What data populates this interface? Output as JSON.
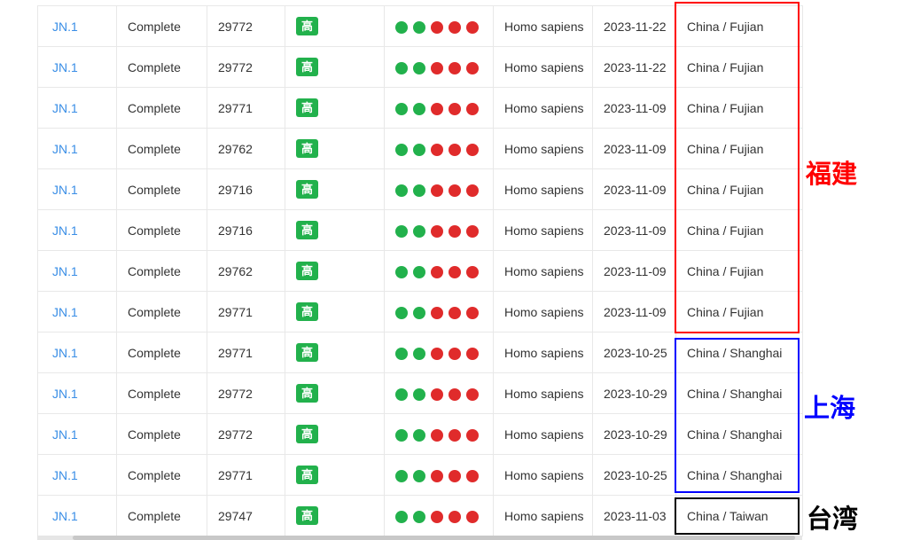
{
  "colors": {
    "dot_green": "#22b14c",
    "dot_red": "#e02b2b",
    "badge": "#22b14c",
    "link": "#3a8ee6",
    "fujian": "#ff0000",
    "shanghai": "#0000ff",
    "taiwan": "#000000"
  },
  "rows": [
    {
      "lineage": "JN.1",
      "status": "Complete",
      "length": "29772",
      "quality": "高",
      "dots": [
        "green",
        "green",
        "red",
        "red",
        "red"
      ],
      "host": "Homo sapiens",
      "date": "2023-11-22",
      "location": "China / Fujian"
    },
    {
      "lineage": "JN.1",
      "status": "Complete",
      "length": "29772",
      "quality": "高",
      "dots": [
        "green",
        "green",
        "red",
        "red",
        "red"
      ],
      "host": "Homo sapiens",
      "date": "2023-11-22",
      "location": "China / Fujian"
    },
    {
      "lineage": "JN.1",
      "status": "Complete",
      "length": "29771",
      "quality": "高",
      "dots": [
        "green",
        "green",
        "red",
        "red",
        "red"
      ],
      "host": "Homo sapiens",
      "date": "2023-11-09",
      "location": "China / Fujian"
    },
    {
      "lineage": "JN.1",
      "status": "Complete",
      "length": "29762",
      "quality": "高",
      "dots": [
        "green",
        "green",
        "red",
        "red",
        "red"
      ],
      "host": "Homo sapiens",
      "date": "2023-11-09",
      "location": "China / Fujian"
    },
    {
      "lineage": "JN.1",
      "status": "Complete",
      "length": "29716",
      "quality": "高",
      "dots": [
        "green",
        "green",
        "red",
        "red",
        "red"
      ],
      "host": "Homo sapiens",
      "date": "2023-11-09",
      "location": "China / Fujian"
    },
    {
      "lineage": "JN.1",
      "status": "Complete",
      "length": "29716",
      "quality": "高",
      "dots": [
        "green",
        "green",
        "red",
        "red",
        "red"
      ],
      "host": "Homo sapiens",
      "date": "2023-11-09",
      "location": "China / Fujian"
    },
    {
      "lineage": "JN.1",
      "status": "Complete",
      "length": "29762",
      "quality": "高",
      "dots": [
        "green",
        "green",
        "red",
        "red",
        "red"
      ],
      "host": "Homo sapiens",
      "date": "2023-11-09",
      "location": "China / Fujian"
    },
    {
      "lineage": "JN.1",
      "status": "Complete",
      "length": "29771",
      "quality": "高",
      "dots": [
        "green",
        "green",
        "red",
        "red",
        "red"
      ],
      "host": "Homo sapiens",
      "date": "2023-11-09",
      "location": "China / Fujian"
    },
    {
      "lineage": "JN.1",
      "status": "Complete",
      "length": "29771",
      "quality": "高",
      "dots": [
        "green",
        "green",
        "red",
        "red",
        "red"
      ],
      "host": "Homo sapiens",
      "date": "2023-10-25",
      "location": "China / Shanghai"
    },
    {
      "lineage": "JN.1",
      "status": "Complete",
      "length": "29772",
      "quality": "高",
      "dots": [
        "green",
        "green",
        "red",
        "red",
        "red"
      ],
      "host": "Homo sapiens",
      "date": "2023-10-29",
      "location": "China / Shanghai"
    },
    {
      "lineage": "JN.1",
      "status": "Complete",
      "length": "29772",
      "quality": "高",
      "dots": [
        "green",
        "green",
        "red",
        "red",
        "red"
      ],
      "host": "Homo sapiens",
      "date": "2023-10-29",
      "location": "China / Shanghai"
    },
    {
      "lineage": "JN.1",
      "status": "Complete",
      "length": "29771",
      "quality": "高",
      "dots": [
        "green",
        "green",
        "red",
        "red",
        "red"
      ],
      "host": "Homo sapiens",
      "date": "2023-10-25",
      "location": "China / Shanghai"
    },
    {
      "lineage": "JN.1",
      "status": "Complete",
      "length": "29747",
      "quality": "高",
      "dots": [
        "green",
        "green",
        "red",
        "red",
        "red"
      ],
      "host": "Homo sapiens",
      "date": "2023-11-03",
      "location": "China / Taiwan"
    }
  ],
  "annotations": {
    "fujian": "福建",
    "shanghai": "上海",
    "taiwan": "台湾"
  }
}
